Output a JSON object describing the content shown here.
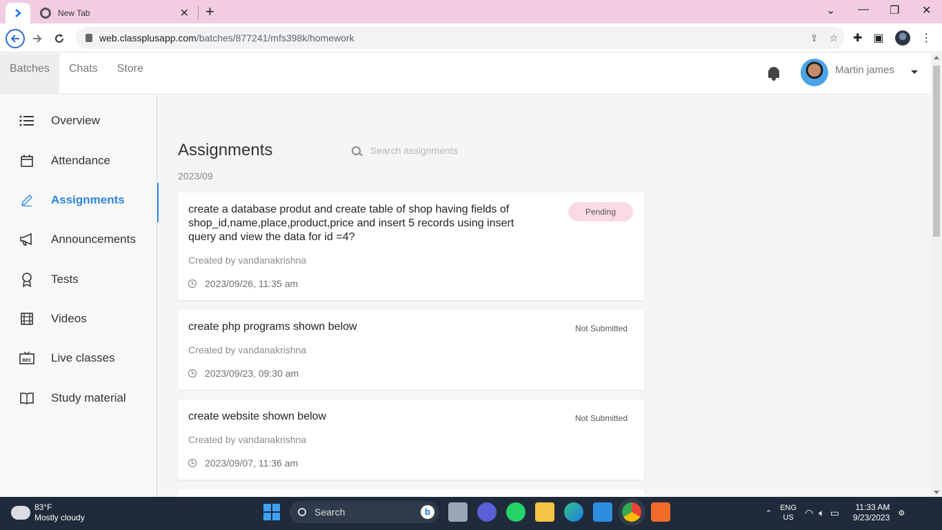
{
  "browser": {
    "tab_title": "New Tab",
    "url_host": "web.classplusapp.com",
    "url_path": "/batches/877241/mfs398k/homework"
  },
  "header": {
    "nav": [
      "Batches",
      "Chats",
      "Store"
    ],
    "user_name": "Martin james"
  },
  "sidebar": {
    "items": [
      {
        "label": "Overview",
        "icon": "list-icon"
      },
      {
        "label": "Attendance",
        "icon": "calendar-icon"
      },
      {
        "label": "Assignments",
        "icon": "pencil-icon"
      },
      {
        "label": "Announcements",
        "icon": "megaphone-icon"
      },
      {
        "label": "Tests",
        "icon": "badge-icon"
      },
      {
        "label": "Videos",
        "icon": "film-icon"
      },
      {
        "label": "Live classes",
        "icon": "rec-icon"
      },
      {
        "label": "Study material",
        "icon": "book-icon"
      }
    ]
  },
  "main": {
    "title": "Assignments",
    "search_placeholder": "Search assignments",
    "month": "2023/09",
    "assignments": [
      {
        "title": "create a database produt and create table of shop having fields of shop_id,name,place,product,price and insert 5 records using insert query and view the data for id =4?",
        "status": "Pending",
        "creator": "Created by vandanakrishna",
        "date": "2023/09/26, 11:35 am"
      },
      {
        "title": "create php programs shown below",
        "status": "Not Submitted",
        "creator": "Created by vandanakrishna",
        "date": "2023/09/23, 09:30 am"
      },
      {
        "title": "create website shown below",
        "status": "Not Submitted",
        "creator": "Created by vandanakrishna",
        "date": "2023/09/07, 11:36 am"
      }
    ]
  },
  "taskbar": {
    "temperature": "83°F",
    "weather": "Mostly cloudy",
    "search_label": "Search",
    "lang_top": "ENG",
    "lang_bottom": "US",
    "time": "11:33 AM",
    "date": "9/23/2023"
  },
  "colors": {
    "accent": "#2e86de",
    "pending_bg": "#fbdbe3",
    "tabbar_bg": "#f2cde1"
  }
}
